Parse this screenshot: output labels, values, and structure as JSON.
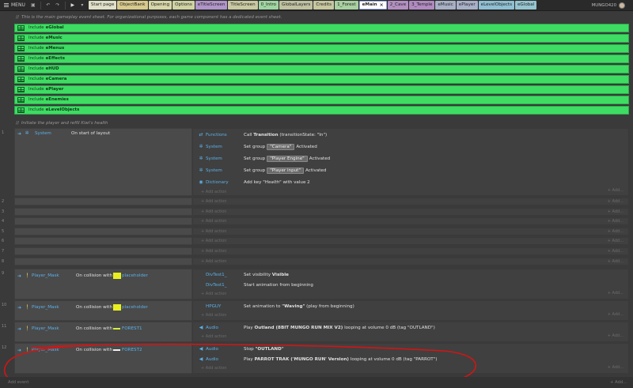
{
  "topbar": {
    "menu_label": "MENU",
    "tabs": [
      {
        "label": "Start page",
        "color": "#e0e0c8",
        "active": false
      },
      {
        "label": "ObjectBank",
        "color": "#d8c98c",
        "active": false
      },
      {
        "label": "Opening",
        "color": "#d6d6a8",
        "active": false
      },
      {
        "label": "Options",
        "color": "#cfd3a2",
        "active": false
      },
      {
        "label": "eTitleScreen",
        "color": "#b095c9",
        "active": false
      },
      {
        "label": "TitleScreen",
        "color": "#c9c9a2",
        "active": false
      },
      {
        "label": "0_Intro",
        "color": "#9fd4a1",
        "active": false
      },
      {
        "label": "GlobalLayers",
        "color": "#bfc1a0",
        "active": false
      },
      {
        "label": "Credits",
        "color": "#c7c7a0",
        "active": false
      },
      {
        "label": "1_Forest",
        "color": "#a8d0a0",
        "active": false
      },
      {
        "label": "eMain",
        "color": "#ffffff",
        "active": true
      },
      {
        "label": "2_Cave",
        "color": "#b28fc0",
        "active": false
      },
      {
        "label": "3_Temple",
        "color": "#b08ac0",
        "active": false
      },
      {
        "label": "eMusic",
        "color": "#a7b0c4",
        "active": false
      },
      {
        "label": "ePlayer",
        "color": "#a8b0c8",
        "active": false
      },
      {
        "label": "eLevelObjects",
        "color": "#8fbfd2",
        "active": false
      },
      {
        "label": "eGlobal",
        "color": "#95c4d0",
        "active": false
      }
    ],
    "user": "MUNGO420"
  },
  "comment1": "This is the main gameplay event sheet. For organizational purposes, each game component has a dedicated event sheet.",
  "includes": [
    {
      "prefix": "Include",
      "name": "eGlobal"
    },
    {
      "prefix": "Include",
      "name": "eMusic"
    },
    {
      "prefix": "Include",
      "name": "eMenus"
    },
    {
      "prefix": "Include",
      "name": "eEffects"
    },
    {
      "prefix": "Include",
      "name": "eHUD"
    },
    {
      "prefix": "Include",
      "name": "eCamera"
    },
    {
      "prefix": "Include",
      "name": "ePlayer"
    },
    {
      "prefix": "Include",
      "name": "eEnemies"
    },
    {
      "prefix": "Include",
      "name": "eLevelObjects"
    }
  ],
  "comment2": "Initiate the player and refill Kiwi's health",
  "event1": {
    "num": "1",
    "obj": "System",
    "cond": "On start of layout",
    "actions": [
      {
        "obj": "Functions",
        "icon": "functions-icon",
        "pre": "Call ",
        "bold": "Transition",
        "post": " (transitionState: \"In\")"
      },
      {
        "obj": "System",
        "icon": "gear-icon",
        "pre": "Set group",
        "pill": "\"Camera\"",
        "post": "Activated"
      },
      {
        "obj": "System",
        "icon": "gear-icon",
        "pre": "Set group",
        "pill": "\"Player Engine\"",
        "post": "Activated"
      },
      {
        "obj": "System",
        "icon": "gear-icon",
        "pre": "Set group",
        "pill": "\"Player input\"",
        "post": "Activated"
      },
      {
        "obj": "Dictionary",
        "icon": "dictionary-icon",
        "pre": "Add key ",
        "italic": "\"Health\"",
        "post": " with value 2"
      }
    ]
  },
  "add_action": "+ Add action",
  "add_right": "+ Add...",
  "empty_rows": [
    "2",
    "3",
    "4",
    "5",
    "6",
    "7",
    "8"
  ],
  "event9": {
    "num": "9",
    "obj": "Player_Mask",
    "cond_pre": "On collision with",
    "target": "placeholder",
    "actions": [
      {
        "obj": "DivTest1_",
        "pre": "Set visibility ",
        "bold": "Visible"
      },
      {
        "obj": "DivTest1_",
        "pre": "Start animation from beginning"
      }
    ]
  },
  "event10": {
    "num": "10",
    "obj": "Player_Mask",
    "cond_pre": "On collision with",
    "target": "placeholder",
    "actions": [
      {
        "obj": "HPGUY",
        "pre": "Set animation to ",
        "bold": "\"Waving\"",
        "post": " (play from beginning)"
      }
    ]
  },
  "event11": {
    "num": "11",
    "obj": "Player_Mask",
    "cond_pre": "On collision with",
    "target": "FOREST1",
    "actions": [
      {
        "obj": "Audio",
        "pre": "Play ",
        "bold": "Outland (8BIT MUNGO RUN MIX V2)",
        "post": " looping at volume 0 dB (tag \"OUTLAND\")"
      }
    ]
  },
  "event12": {
    "num": "12",
    "obj": "Player_Mask",
    "cond_pre": "On collision with",
    "target": "FOREST2",
    "actions": [
      {
        "obj": "Audio",
        "pre": "Stop ",
        "bold": "\"OUTLAND\""
      },
      {
        "obj": "Audio",
        "pre": "Play ",
        "bold": "PARROT TRAK ('MUNGO RUN' Version)",
        "post": " looping at volume 0 dB (tag \"PARROT\")"
      }
    ]
  },
  "bottom": {
    "left": "Add event",
    "right": "+ Add..."
  },
  "annotation_color": "#d41414"
}
